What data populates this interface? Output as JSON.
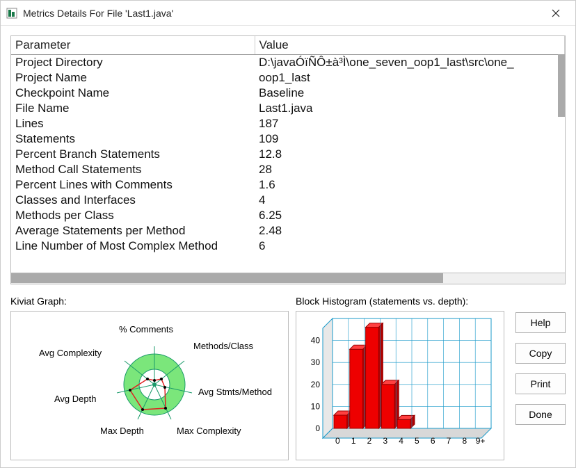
{
  "window": {
    "title": "Metrics Details For File 'Last1.java'"
  },
  "table": {
    "headers": {
      "param": "Parameter",
      "value": "Value"
    },
    "rows": [
      {
        "param": "Project Directory",
        "value": "D:\\javaÓïÑÔ±à³Ì\\one_seven_oop1_last\\src\\one_"
      },
      {
        "param": "Project Name",
        "value": "oop1_last"
      },
      {
        "param": "Checkpoint Name",
        "value": "Baseline"
      },
      {
        "param": "File Name",
        "value": "Last1.java"
      },
      {
        "param": "Lines",
        "value": "187"
      },
      {
        "param": "Statements",
        "value": "109"
      },
      {
        "param": "Percent Branch Statements",
        "value": "12.8"
      },
      {
        "param": "Method Call Statements",
        "value": "28"
      },
      {
        "param": "Percent Lines with Comments",
        "value": "1.6"
      },
      {
        "param": "Classes and Interfaces",
        "value": "4"
      },
      {
        "param": "Methods per Class",
        "value": "6.25"
      },
      {
        "param": "Average Statements per Method",
        "value": "2.48"
      },
      {
        "param": "Line Number of Most Complex Method",
        "value": "6"
      }
    ]
  },
  "kiviat": {
    "title": "Kiviat Graph:",
    "labels": {
      "top": "% Comments",
      "topright": "Methods/Class",
      "right": "Avg Stmts/Method",
      "botright": "Max Complexity",
      "botleft": "Max Depth",
      "left": "Avg Depth",
      "topleft": "Avg Complexity"
    }
  },
  "histogram": {
    "title": "Block Histogram (statements vs. depth):"
  },
  "chart_data": {
    "type": "bar",
    "categories": [
      "0",
      "1",
      "2",
      "3",
      "4",
      "5",
      "6",
      "7",
      "8",
      "9+"
    ],
    "values": [
      6,
      36,
      46,
      20,
      4,
      0,
      0,
      0,
      0,
      0
    ],
    "xlabel": "depth",
    "ylabel": "statements",
    "ylim": [
      0,
      50
    ],
    "yticks": [
      0,
      10,
      20,
      30,
      40
    ]
  },
  "buttons": {
    "help": "Help",
    "copy": "Copy",
    "print": "Print",
    "done": "Done"
  }
}
